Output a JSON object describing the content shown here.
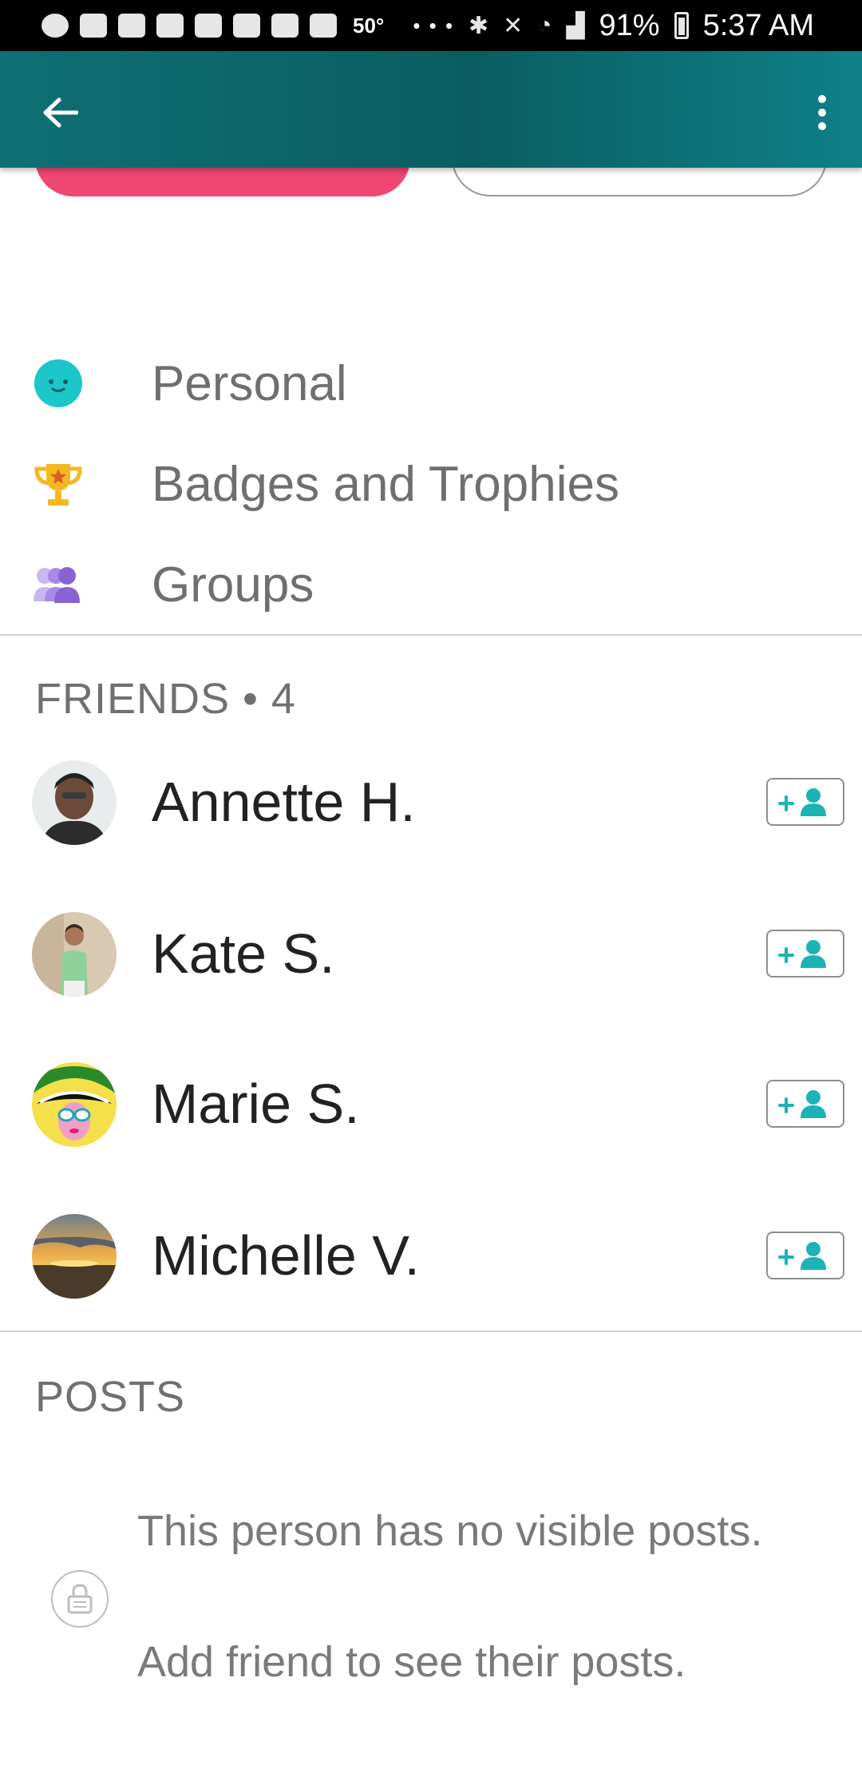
{
  "status_bar": {
    "temperature": "50°",
    "overflow": "• • •",
    "battery": "91%",
    "time": "5:37 AM"
  },
  "app_bar": {
    "back_icon": "arrow-left-icon",
    "more_icon": "more-vertical-icon"
  },
  "menu": [
    {
      "label": "Personal",
      "icon": "smiley-face-icon",
      "color": "#1cc6c9"
    },
    {
      "label": "Badges and Trophies",
      "icon": "trophy-icon",
      "color": "#f5b820"
    },
    {
      "label": "Groups",
      "icon": "groups-icon",
      "color": "#8a63d2"
    }
  ],
  "friends": {
    "heading": "FRIENDS • 4",
    "items": [
      {
        "name": "Annette H."
      },
      {
        "name": "Kate S."
      },
      {
        "name": "Marie S."
      },
      {
        "name": "Michelle V."
      }
    ],
    "add_icon": "add-friend-icon",
    "accent": "#1cb3b4"
  },
  "posts": {
    "heading": "POSTS",
    "empty_line1": "This person has no visible posts.",
    "empty_line2": "Add friend to see their posts."
  },
  "colors": {
    "app_bar": "#0a6468",
    "primary_button": "#ef4672"
  }
}
